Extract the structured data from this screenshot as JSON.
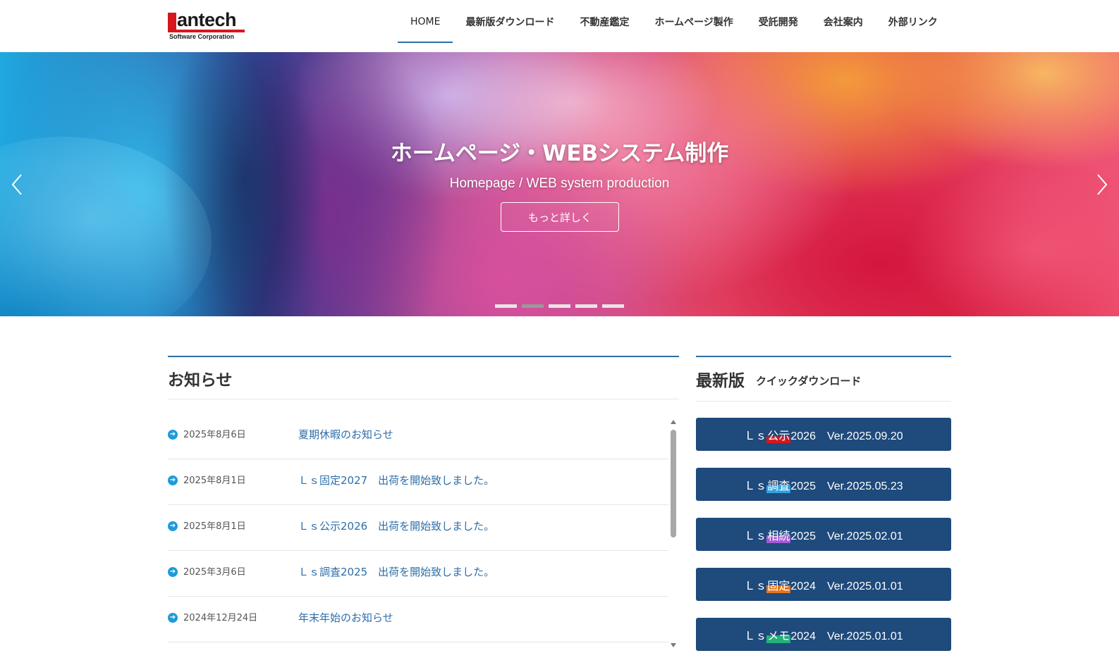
{
  "header": {
    "logo_text": "antech",
    "logo_sub": "Software Corporation",
    "nav": [
      {
        "label": "HOME",
        "active": true
      },
      {
        "label": "最新版ダウンロード"
      },
      {
        "label": "不動産鑑定"
      },
      {
        "label": "ホームページ製作"
      },
      {
        "label": "受託開発"
      },
      {
        "label": "会社案内"
      },
      {
        "label": "外部リンク"
      }
    ]
  },
  "hero": {
    "title": "ホームページ・WEBシステム制作",
    "subtitle": "Homepage / WEB system production",
    "button": "もっと詳しく",
    "prev_icon": "chevron-left-icon",
    "next_icon": "chevron-right-icon",
    "slide_count": 5,
    "active_slide": 2
  },
  "news": {
    "title": "お知らせ",
    "items": [
      {
        "date": "2025年8月6日",
        "text": "夏期休暇のお知らせ"
      },
      {
        "date": "2025年8月1日",
        "text": "Ｌｓ固定2027　出荷を開始致しました。"
      },
      {
        "date": "2025年8月1日",
        "text": "Ｌｓ公示2026　出荷を開始致しました。"
      },
      {
        "date": "2025年3月6日",
        "text": "Ｌｓ調査2025　出荷を開始致しました。"
      },
      {
        "date": "2024年12月24日",
        "text": "年末年始のお知らせ"
      }
    ]
  },
  "latest": {
    "title": "最新版",
    "subtitle": "クイックダウンロード",
    "buttons": [
      {
        "prefix": "Ｌｓ",
        "name": "公示",
        "suffix": "2026　Ver.2025.09.20",
        "highlight": "#d7161e"
      },
      {
        "prefix": "Ｌｓ",
        "name": "調査",
        "suffix": "2025　Ver.2025.05.23",
        "highlight": "#2ba3e3"
      },
      {
        "prefix": "Ｌｓ",
        "name": "相続",
        "suffix": "2025　Ver.2025.02.01",
        "highlight": "#a35ad6"
      },
      {
        "prefix": "Ｌｓ",
        "name": "固定",
        "suffix": "2024　Ver.2025.01.01",
        "highlight": "#e8731c"
      },
      {
        "prefix": "Ｌｓ",
        "name": "メモ",
        "suffix": "2024　Ver.2025.01.01",
        "highlight": "#23b07a"
      }
    ]
  },
  "colors": {
    "accent": "#2d6ea8",
    "button_bg": "#1e4a7c",
    "brand_red": "#d7161e"
  }
}
